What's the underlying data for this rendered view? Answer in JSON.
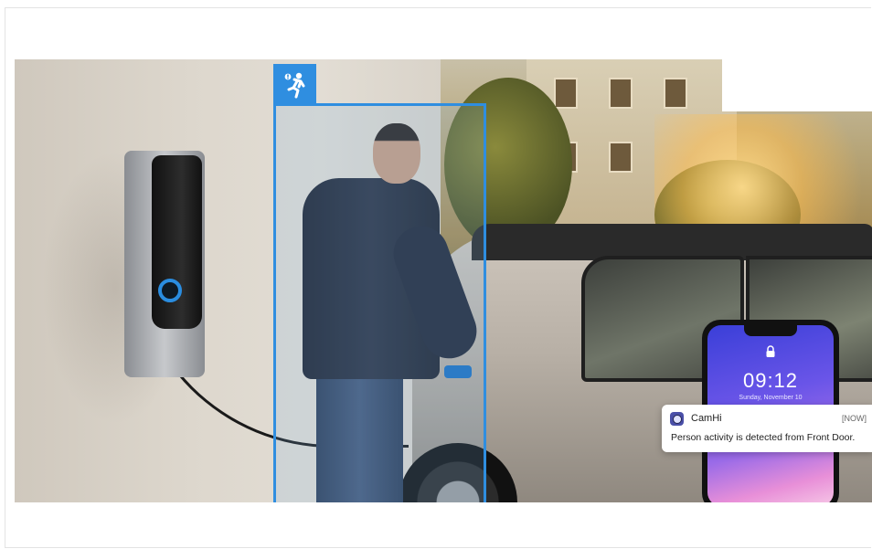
{
  "notification": {
    "app_name": "CamHi",
    "time_label": "[NOW]",
    "message": "Person activity is detected from Front Door."
  },
  "phone": {
    "time": "09:12",
    "date": "Sunday, November 10"
  },
  "icons": {
    "detection": "running-person-icon",
    "lock": "lock-icon",
    "app": "camhi-app-icon"
  },
  "colors": {
    "detection_accent": "#2f8ee0",
    "notification_bg": "#ffffff"
  }
}
